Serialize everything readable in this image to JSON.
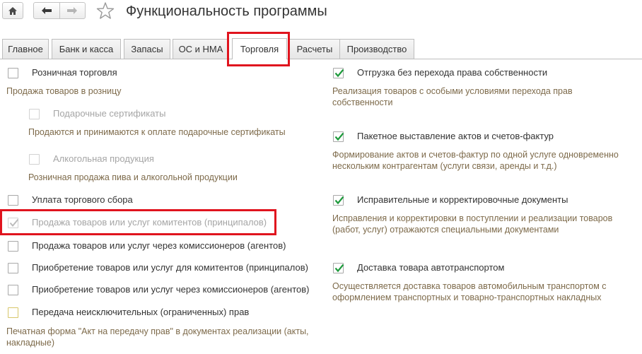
{
  "header": {
    "title": "Функциональность программы",
    "icons": [
      "home-icon",
      "back-arrow-icon",
      "forward-arrow-icon",
      "star-icon"
    ]
  },
  "tabs": [
    "Главное",
    "Банк и касса",
    "Запасы",
    "ОС и НМА",
    "Торговля",
    "Расчеты",
    "Производство"
  ],
  "active_tab": "Торговля",
  "left": {
    "retail": {
      "label": "Розничная торговля",
      "checked": false,
      "desc": "Продажа товаров в розницу"
    },
    "gift": {
      "label": "Подарочные сертификаты",
      "checked": false,
      "disabled": true,
      "desc": "Продаются и принимаются к оплате подарочные сертификаты"
    },
    "alcohol": {
      "label": "Алкогольная продукция",
      "checked": false,
      "disabled": true,
      "desc": "Розничная продажа пива и алкогольной продукции"
    },
    "trade_fee": {
      "label": "Уплата торгового сбора",
      "checked": false
    },
    "committent_sales": {
      "label": "Продажа товаров или услуг комитентов (принципалов)",
      "checked": true,
      "disabled": true
    },
    "agent_sales": {
      "label": "Продажа товаров или услуг через комиссионеров (агентов)",
      "checked": false
    },
    "committent_purchase": {
      "label": "Приобретение товаров или услуг для комитентов (принципалов)",
      "checked": false
    },
    "agent_purchase": {
      "label": "Приобретение товаров или услуг через комиссионеров (агентов)",
      "checked": false
    },
    "rights": {
      "label": "Передача неисключительных (ограниченных) прав",
      "checked": false,
      "desc1": "Печатная форма \"Акт на передачу прав\" в документах реализации (акты,",
      "desc2": "накладные)"
    }
  },
  "right": {
    "shipment": {
      "label": "Отгрузка без перехода права собственности",
      "checked": true,
      "desc1": "Реализация товаров с особыми условиями перехода прав",
      "desc2": "собственности"
    },
    "batch": {
      "label": "Пакетное выставление актов и счетов-фактур",
      "checked": true,
      "desc1": "Формирование актов и счетов-фактур по одной услуге одновременно",
      "desc2": "нескольким контрагентам (услуги связи, аренды и т.д.)"
    },
    "corrections": {
      "label": "Исправительные и корректировочные документы",
      "checked": true,
      "desc1": "Исправления и корректировки в поступлении и реализации товаров",
      "desc2": "(работ, услуг) отражаются специальными документами"
    },
    "delivery": {
      "label": "Доставка товара автотранспортом",
      "checked": true,
      "desc1": "Осуществляется доставка товаров автомобильным транспортом с",
      "desc2": "оформлением транспортных и товарно-транспортных накладных"
    }
  },
  "colors": {
    "check_green": "#1e9a3c",
    "highlight_red": "#e0141e",
    "desc_brown": "#7d6a4a",
    "disabled_grey": "#a5a5a5"
  }
}
